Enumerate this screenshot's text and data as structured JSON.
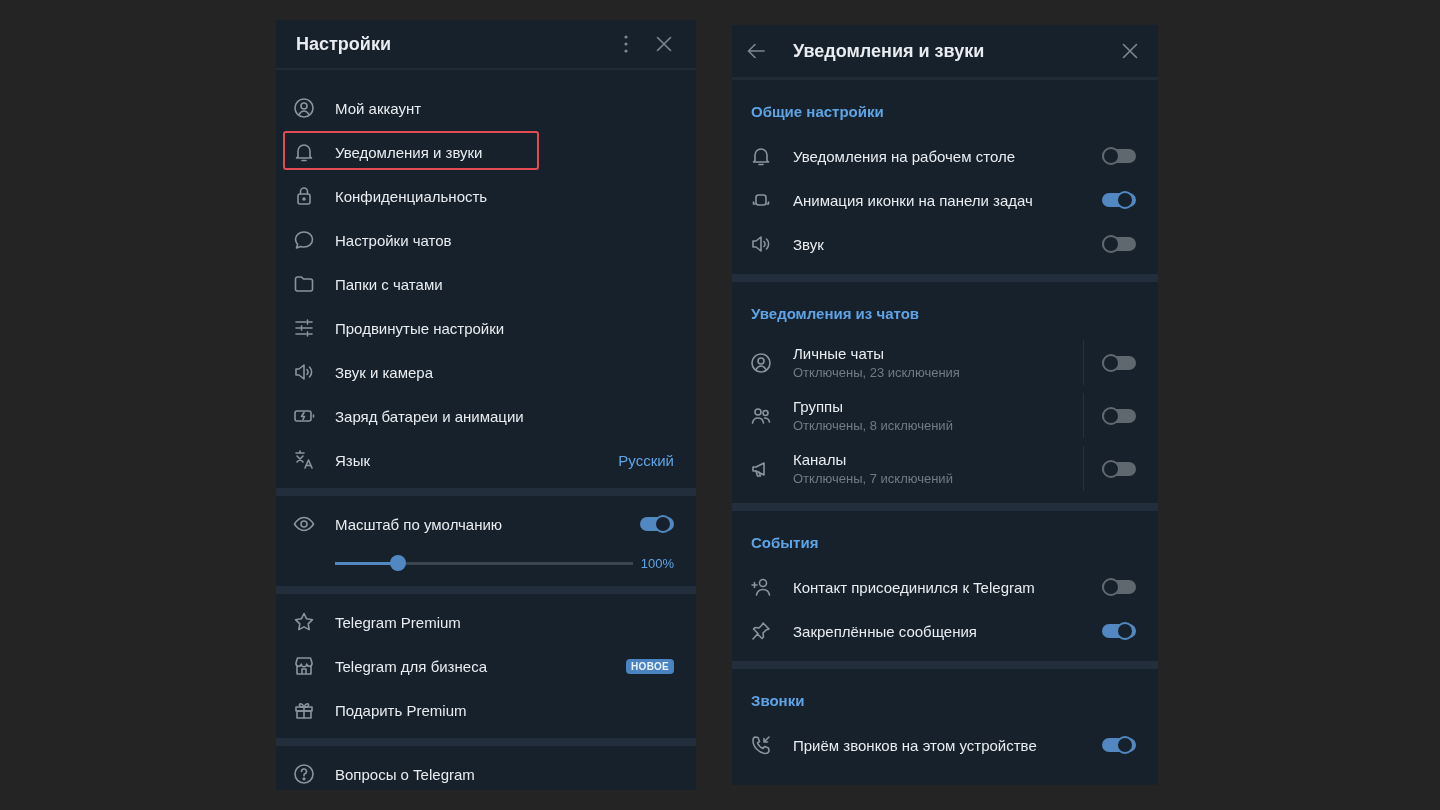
{
  "settings_panel": {
    "title": "Настройки",
    "sections": [
      {
        "kind": "menu",
        "items": [
          {
            "label": "Мой аккаунт",
            "highlighted": false
          },
          {
            "label": "Уведомления и звуки",
            "highlighted": true
          },
          {
            "label": "Конфиденциальность",
            "highlighted": false
          },
          {
            "label": "Настройки чатов",
            "highlighted": false
          },
          {
            "label": "Папки с чатами",
            "highlighted": false
          },
          {
            "label": "Продвинутые настройки",
            "highlighted": false
          },
          {
            "label": "Звук и камера",
            "highlighted": false
          },
          {
            "label": "Заряд батареи и анимации",
            "highlighted": false
          },
          {
            "label": "Язык",
            "value": "Русский",
            "highlighted": false
          }
        ]
      },
      {
        "kind": "scale",
        "label": "Масштаб по умолчанию",
        "on": true,
        "level": 0.21,
        "reading": "100%"
      },
      {
        "kind": "menu",
        "items": [
          {
            "label": "Telegram Premium",
            "highlighted": false
          },
          {
            "label": "Telegram для бизнеса",
            "badge": "НОВОЕ",
            "highlighted": false
          },
          {
            "label": "Подарить Premium",
            "highlighted": false
          }
        ]
      },
      {
        "kind": "menu",
        "items": [
          {
            "label": "Вопросы о Telegram",
            "highlighted": false
          }
        ]
      }
    ]
  },
  "notifications_panel": {
    "title": "Уведомления и звуки",
    "sections": [
      {
        "title": "Общие настройки",
        "rows": [
          {
            "label": "Уведомления на рабочем столе",
            "on": false
          },
          {
            "label": "Анимация иконки на панели задач",
            "on": true
          },
          {
            "label": "Звук",
            "on": false
          }
        ]
      },
      {
        "title": "Уведомления из чатов",
        "rows": [
          {
            "label": "Личные чаты",
            "description": "Отключены, 23 исключения",
            "on": false
          },
          {
            "label": "Группы",
            "description": "Отключены, 8 исключений",
            "on": false
          },
          {
            "label": "Каналы",
            "description": "Отключены, 7 исключений",
            "on": false
          }
        ]
      },
      {
        "title": "События",
        "rows": [
          {
            "label": "Контакт присоединился к Telegram",
            "on": false
          },
          {
            "label": "Закреплённые сообщения",
            "on": true
          }
        ]
      },
      {
        "title": "Звонки",
        "rows": [
          {
            "label": "Приём звонков на этом устройстве",
            "on": true
          }
        ]
      }
    ]
  }
}
